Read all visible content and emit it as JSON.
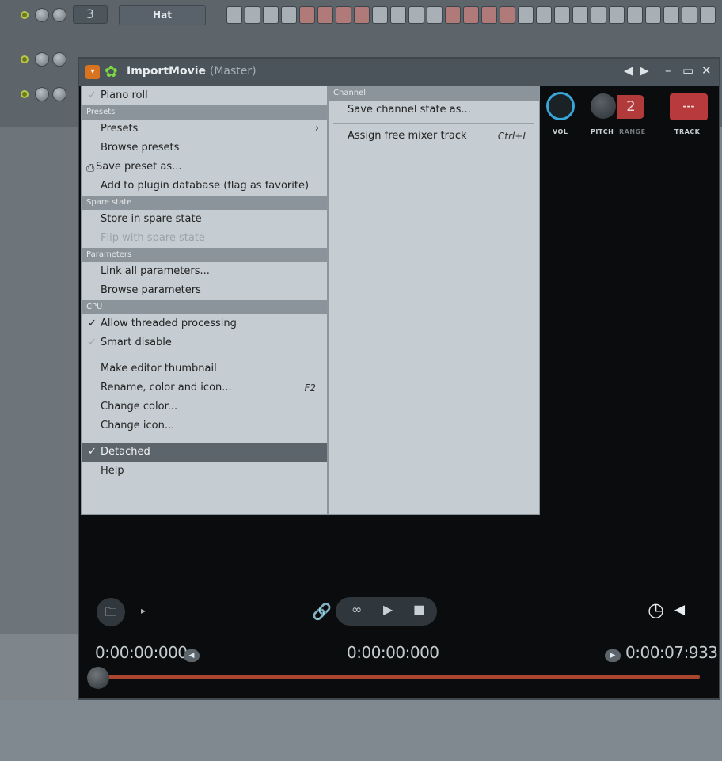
{
  "rack": {
    "rows": [
      {
        "num": "3",
        "name": "Hat"
      },
      {
        "num": "",
        "name": ""
      },
      {
        "num": "",
        "name": ""
      }
    ]
  },
  "window": {
    "title": "ImportMovie",
    "subtitle": "(Master)",
    "controls": {
      "vol_label": "VOL",
      "pitch_label": "PITCH",
      "range_label": "RANGE",
      "range_value": "2",
      "track_label": "TRACK",
      "track_value": "---"
    }
  },
  "menu_left": {
    "piano_roll": "Piano roll",
    "presets_header": "Presets",
    "presets": "Presets",
    "browse_presets": "Browse presets",
    "save_preset": "Save preset as...",
    "add_plugin_db": "Add to plugin database (flag as favorite)",
    "spare_header": "Spare state",
    "store_spare": "Store in spare state",
    "flip_spare": "Flip with spare state",
    "params_header": "Parameters",
    "link_params": "Link all parameters...",
    "browse_params": "Browse parameters",
    "cpu_header": "CPU",
    "allow_threaded": "Allow threaded processing",
    "smart_disable": "Smart disable",
    "make_thumb": "Make editor thumbnail",
    "rename": "Rename, color and icon...",
    "rename_shortcut": "F2",
    "change_color": "Change color...",
    "change_icon": "Change icon...",
    "detached": "Detached",
    "help": "Help"
  },
  "menu_right": {
    "channel_header": "Channel",
    "save_channel_state": "Save channel state as...",
    "assign_mixer": "Assign free mixer track",
    "assign_shortcut": "Ctrl+L"
  },
  "transport": {
    "time_start": "0:00:00:000",
    "time_current": "0:00:00:000",
    "time_end": "0:00:07:933"
  },
  "colors": {
    "accent_orange": "#d9731f",
    "accent_green": "#7dd842",
    "track_red": "#b83a3c",
    "vol_blue": "#39a6d9",
    "timeline": "#a8462f"
  }
}
